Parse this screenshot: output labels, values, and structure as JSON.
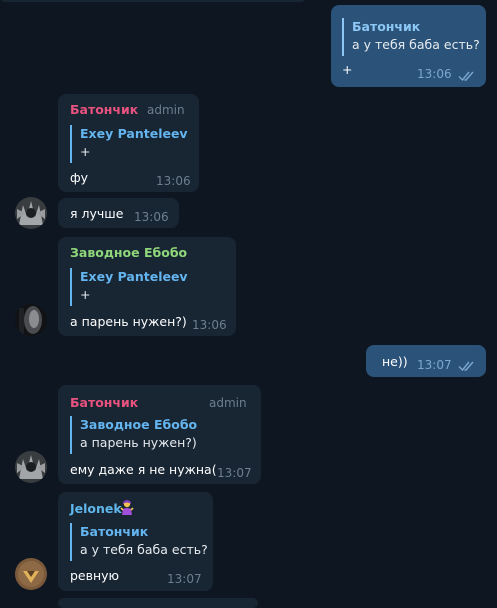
{
  "colors": {
    "background": "#0e1621",
    "incoming_bubble": "#182533",
    "outgoing_bubble": "#2b5278",
    "sender_batonchik": "#e8527e",
    "sender_zavodnoe": "#8fd77a",
    "sender_jelonek": "#5fb7ec",
    "quote_accent": "#64b5ef"
  },
  "messages": [
    {
      "quote": {
        "name": "Батончик",
        "text": "а у тебя баба есть?"
      },
      "text": "+",
      "time": "13:06"
    },
    {
      "sender": "Батончик",
      "role": "admin",
      "quote": {
        "name": "Exey Panteleev",
        "text": "+"
      },
      "text": "фу",
      "time": "13:06"
    },
    {
      "text": "я лучше",
      "time": "13:06"
    },
    {
      "sender": "Заводное Ебобо",
      "quote": {
        "name": "Exey Panteleev",
        "text": "+"
      },
      "text": "а парень нужен?)",
      "time": "13:06"
    },
    {
      "text": "не))",
      "time": "13:07"
    },
    {
      "sender": "Батончик",
      "role": "admin",
      "quote": {
        "name": "Заводное Ебобо",
        "text": "а парень нужен?)"
      },
      "text": "ему даже я не нужна(",
      "time": "13:07"
    },
    {
      "sender": "Jelonek",
      "sender_emoji_icon": "person-gesturing-emoji-icon",
      "quote": {
        "name": "Батончик",
        "text": "а у тебя баба есть?"
      },
      "text": "ревную",
      "time": "13:07"
    }
  ]
}
